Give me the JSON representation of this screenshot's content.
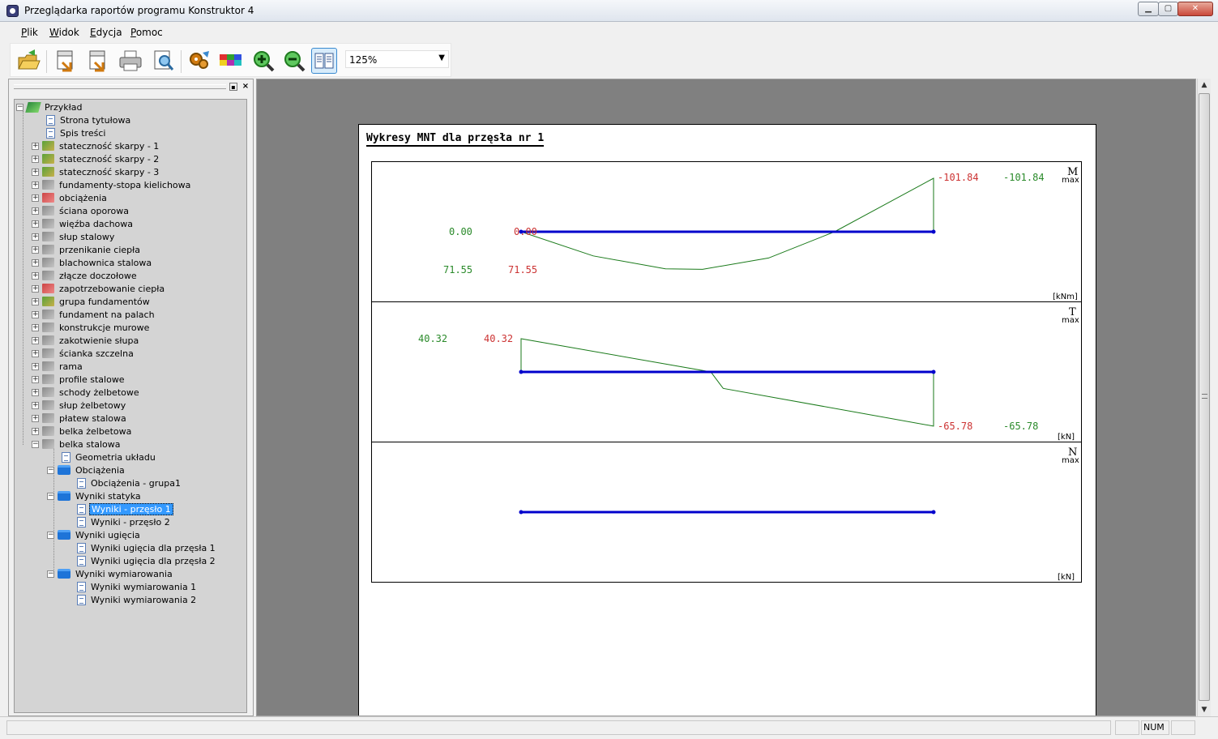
{
  "window": {
    "title": "Przeglądarka raportów programu Konstruktor 4",
    "min_label": "▁",
    "max_label": "▢",
    "close_label": "✕"
  },
  "menu": [
    {
      "label": "Plik"
    },
    {
      "label": "Widok"
    },
    {
      "label": "Edycja"
    },
    {
      "label": "Pomoc"
    }
  ],
  "toolbar": {
    "buttons": [
      "open-icon",
      "export-html-icon",
      "export-rtf-icon",
      "print-icon",
      "print-preview-icon",
      "settings-icon",
      "colors-icon",
      "zoom-in-icon",
      "zoom-out-icon",
      "page-view-icon"
    ],
    "zoom": "125%"
  },
  "tree": {
    "root": "Przykład",
    "items": [
      {
        "label": "Strona tytułowa"
      },
      {
        "label": "Spis treści"
      },
      {
        "label": "stateczność skarpy - 1"
      },
      {
        "label": "stateczność skarpy - 2"
      },
      {
        "label": "stateczność skarpy - 3"
      },
      {
        "label": "fundamenty-stopa kielichowa"
      },
      {
        "label": "obciążenia"
      },
      {
        "label": "ściana oporowa"
      },
      {
        "label": "więźba dachowa"
      },
      {
        "label": "słup stalowy"
      },
      {
        "label": "przenikanie ciepła"
      },
      {
        "label": "blachownica stalowa"
      },
      {
        "label": "złącze doczołowe"
      },
      {
        "label": "zapotrzebowanie ciepła"
      },
      {
        "label": "grupa fundamentów"
      },
      {
        "label": "fundament na palach"
      },
      {
        "label": "konstrukcje murowe"
      },
      {
        "label": "zakotwienie słupa"
      },
      {
        "label": "ścianka szczelna"
      },
      {
        "label": "rama"
      },
      {
        "label": "profile stalowe"
      },
      {
        "label": "schody żelbetowe"
      },
      {
        "label": "słup żelbetowy"
      },
      {
        "label": "płatew stalowa"
      },
      {
        "label": "belka żelbetowa"
      },
      {
        "label": "belka stalowa"
      },
      {
        "label": "Geometria układu"
      },
      {
        "label": "Obciążenia"
      },
      {
        "label": "Obciążenia - grupa1"
      },
      {
        "label": "Wyniki statyka"
      },
      {
        "label": "Wyniki - przęsło 1"
      },
      {
        "label": "Wyniki - przęsło 2"
      },
      {
        "label": "Wyniki ugięcia"
      },
      {
        "label": "Wyniki ugięcia dla przęsła 1"
      },
      {
        "label": "Wyniki ugięcia dla przęsła 2"
      },
      {
        "label": "Wyniki wymiarowania"
      },
      {
        "label": "Wyniki wymiarowania 1"
      },
      {
        "label": "Wyniki wymiarowania 2"
      }
    ]
  },
  "report": {
    "heading": "Wykresy MNT dla przęsła nr 1",
    "colors": {
      "beam": "#0000cc",
      "curve": "#1a7a1a",
      "green_text": "#2a8a2a",
      "red_text": "#cc3333"
    }
  },
  "chart_data": [
    {
      "type": "line",
      "name": "M",
      "symbol": "M",
      "subscript": "max",
      "unit": "[kNm]",
      "x": [
        0.0,
        0.175,
        0.35,
        0.44,
        0.6,
        0.76,
        1.0
      ],
      "y": [
        0.0,
        -46.0,
        -70.5,
        -71.55,
        -50.0,
        0.0,
        101.84
      ],
      "left_labels": {
        "value_green": "0.00",
        "value_red": "0.00",
        "min_green": "71.55",
        "min_red": "71.55"
      },
      "right_labels": {
        "value_red": "-101.84",
        "value_green": "-101.84"
      }
    },
    {
      "type": "line",
      "name": "T",
      "symbol": "T",
      "subscript": "max",
      "unit": "[kN]",
      "x": [
        0.0,
        0.46,
        0.49,
        1.0
      ],
      "y": [
        40.32,
        0.0,
        -20.0,
        -65.78
      ],
      "left_labels": {
        "value_green": "40.32",
        "value_red": "40.32"
      },
      "right_labels": {
        "value_red": "-65.78",
        "value_green": "-65.78"
      }
    },
    {
      "type": "line",
      "name": "N",
      "symbol": "N",
      "subscript": "max",
      "unit": "[kN]",
      "x": [
        0.0,
        1.0
      ],
      "y": [
        0.0,
        0.0
      ]
    }
  ],
  "statusbar": {
    "num": "NUM"
  }
}
